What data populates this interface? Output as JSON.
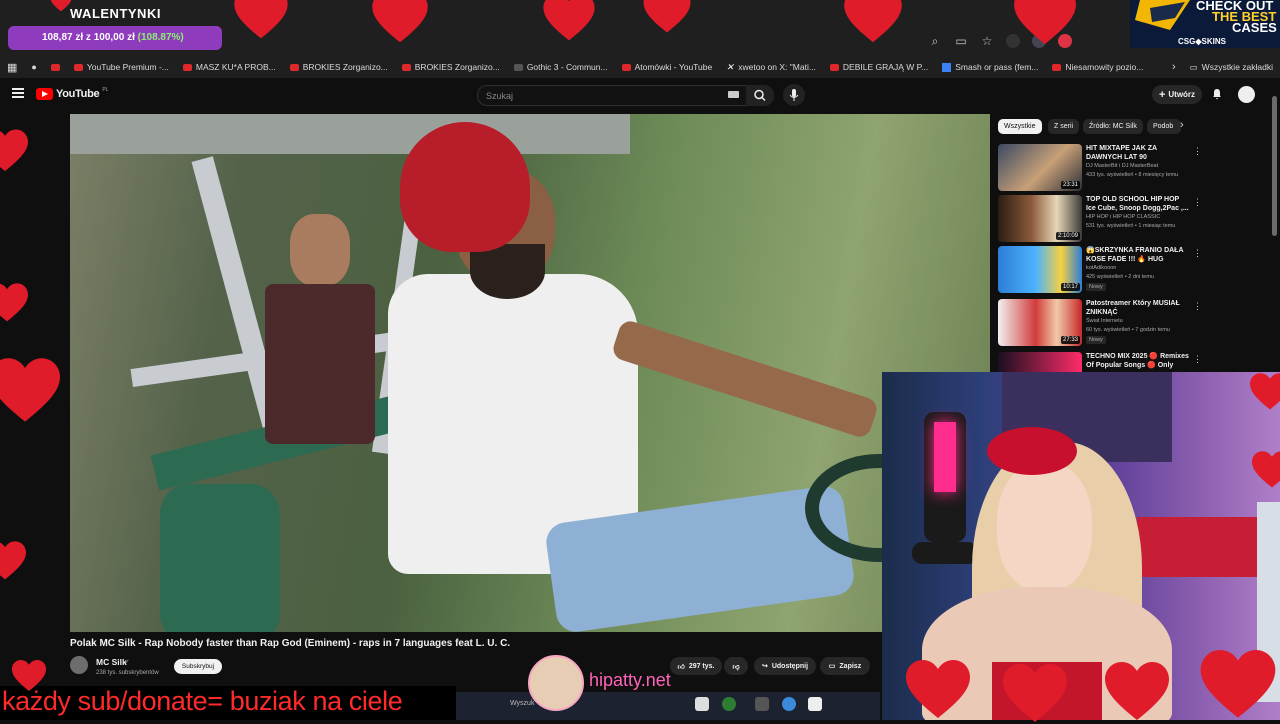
{
  "browser": {
    "bookmarks": [
      {
        "label": "YouTube Premium -..."
      },
      {
        "label": "MASZ KU*A PROB..."
      },
      {
        "label": "BROKIES Zorganizo..."
      },
      {
        "label": "BROKIES Zorganizo..."
      },
      {
        "label": "Gothic 3 - Commun..."
      },
      {
        "label": "Atomówki - YouTube"
      },
      {
        "label": "xwetoo on X: \"Mati..."
      },
      {
        "label": "DEBILE GRAJĄ W P..."
      },
      {
        "label": "Smash or pass (fem..."
      },
      {
        "label": "Niesamowity pozio..."
      }
    ],
    "all_bookmarks_label": "Wszystkie zakładki"
  },
  "youtube": {
    "logo_text": "YouTube",
    "country": "PL",
    "search_placeholder": "Szukaj",
    "create_label": "Utwórz",
    "video": {
      "title": "Polak MC Silk - Rap Nobody faster than Rap God (Eminem) - raps in 7 languages feat L. U. C.",
      "channel_name": "MC Silk",
      "subscribers": "238 tys. subskrybentów",
      "subscribe_label": "Subskrybuj",
      "likes": "297 tys.",
      "share_label": "Udostępnij",
      "save_label": "Zapisz"
    },
    "chips": [
      "Wszystkie",
      "Z serii",
      "Źródło: MC Silk",
      "Podob"
    ],
    "recommendations": [
      {
        "title": "HIT MIXTAPE JAK ZA DAWNYCH LAT 90",
        "channel": "DJ MasterBit i DJ MasterBeat",
        "meta": "433 tys. wyświetleń • 8 miesięcy temu",
        "duration": "23:31",
        "badge": ""
      },
      {
        "title": "TOP OLD SCHOOL HIP HOP Ice Cube, Snoop Dogg,2Pac ,...",
        "channel": "HIP HOP i HIP HOP CLASSIC",
        "meta": "531 tys. wyświetleń • 1 miesiąc temu",
        "duration": "2:10:09",
        "badge": ""
      },
      {
        "title": "😱SKRZYNKA FRANIO DAŁA KOSE FADE !!! 🔥 HUG",
        "channel": "kotAdikooon",
        "meta": "425 wyświetleń • 2 dni temu",
        "duration": "10:17",
        "badge": "Nowy"
      },
      {
        "title": "Patostreamer Który MUSIAŁ ZNIKNĄĆ",
        "channel": "Świat Internetu",
        "meta": "60 tys. wyświetleń • 7 godzin temu",
        "duration": "27:33",
        "badge": "Nowy"
      },
      {
        "title": "TECHNO MIX 2025 🔴 Remixes Of Popular Songs 🔴 Only",
        "channel": "",
        "meta": "",
        "duration": "",
        "badge": ""
      }
    ]
  },
  "stream_overlay": {
    "donation_title": "WALENTYNKI",
    "donation_amount": "108,87 zł z 100,00 zł ",
    "donation_percent": "(108.87%)",
    "donation_progress": 1.0887,
    "promo_line1": "CHECK OUT",
    "promo_line2": "THE BEST",
    "promo_line3": "CASES",
    "promo_brand": "CSG◆SKINS",
    "banner_text": "każdy sub/donate= buziak na ciele",
    "streamer_handle": "hipatty.net",
    "taskbar_search": "Wyszuk"
  },
  "colors": {
    "youtube_red": "#ff0000",
    "heart_red": "#e01b2a",
    "banner_text": "#ff2b2b",
    "handle_pink": "#ff63b8",
    "donation_bar": "#8e3bbd"
  }
}
